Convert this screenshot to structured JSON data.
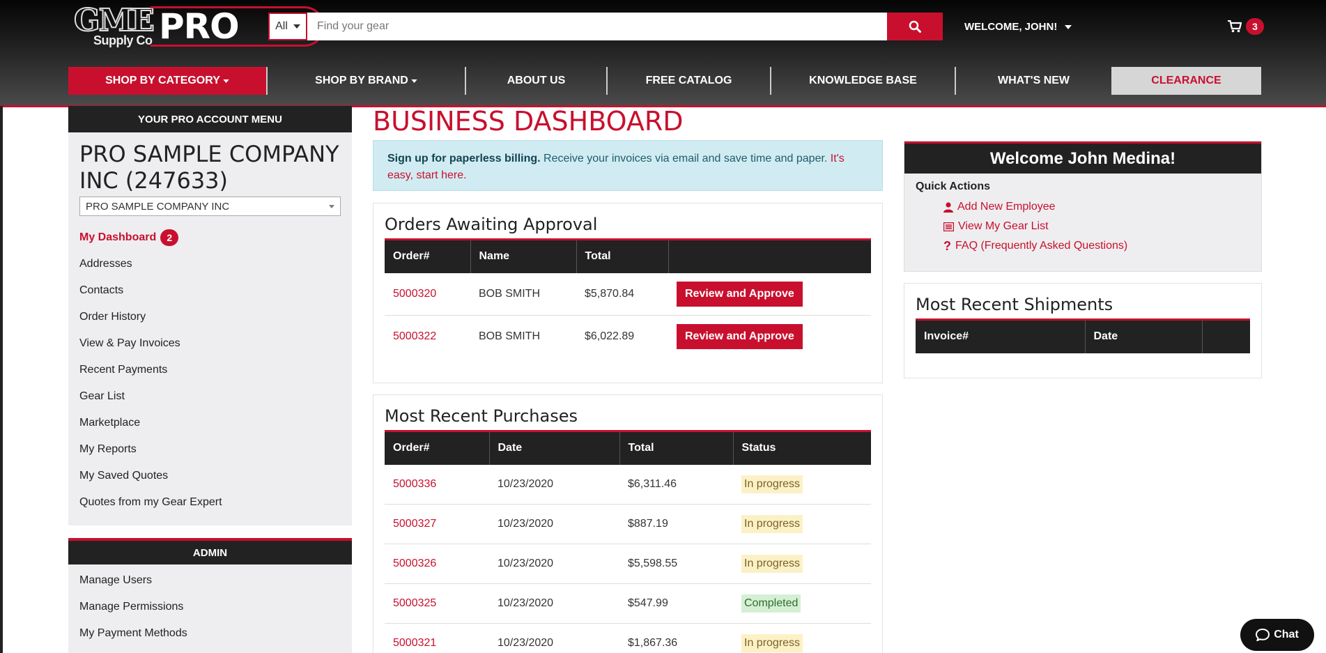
{
  "header": {
    "logo": {
      "brand": "GME",
      "sub": "Supply Co",
      "pro": "PRO"
    },
    "search": {
      "category": "All",
      "placeholder": "Find your gear"
    },
    "welcome": "WELCOME, JOHN!",
    "cart_count": "3"
  },
  "nav": [
    {
      "label": "SHOP BY CATEGORY",
      "caret": true
    },
    {
      "label": "SHOP BY BRAND",
      "caret": true
    },
    {
      "label": "ABOUT US"
    },
    {
      "label": "FREE CATALOG"
    },
    {
      "label": "KNOWLEDGE BASE"
    },
    {
      "label": "WHAT'S NEW"
    },
    {
      "label": "CLEARANCE"
    }
  ],
  "sidebar": {
    "header": "YOUR PRO ACCOUNT MENU",
    "company": "PRO SAMPLE COMPANY INC (247633)",
    "company_select": "PRO SAMPLE COMPANY INC",
    "links": [
      {
        "label": "My Dashboard",
        "badge": "2"
      },
      {
        "label": "Addresses"
      },
      {
        "label": "Contacts"
      },
      {
        "label": "Order History"
      },
      {
        "label": "View & Pay Invoices"
      },
      {
        "label": "Recent Payments"
      },
      {
        "label": "Gear List"
      },
      {
        "label": "Marketplace"
      },
      {
        "label": "My Reports"
      },
      {
        "label": "My Saved Quotes"
      },
      {
        "label": "Quotes from my Gear Expert"
      }
    ],
    "admin_header": "ADMIN",
    "admin_links": [
      "Manage Users",
      "Manage Permissions",
      "My Payment Methods"
    ]
  },
  "main": {
    "title": "BUSINESS DASHBOARD",
    "notice": {
      "bold": "Sign up for paperless billing.",
      "text": " Receive your invoices via email and save time and paper. ",
      "link": "It's easy, start here."
    },
    "approval": {
      "title": "Orders Awaiting Approval",
      "columns": [
        "Order#",
        "Name",
        "Total",
        ""
      ],
      "rows": [
        {
          "order": "5000320",
          "name": "BOB SMITH",
          "total": "$5,870.84",
          "action": "Review and Approve"
        },
        {
          "order": "5000322",
          "name": "BOB SMITH",
          "total": "$6,022.89",
          "action": "Review and Approve"
        }
      ]
    },
    "purchases": {
      "title": "Most Recent Purchases",
      "columns": [
        "Order#",
        "Date",
        "Total",
        "Status"
      ],
      "rows": [
        {
          "order": "5000336",
          "date": "10/23/2020",
          "total": "$6,311.46",
          "status": "In progress"
        },
        {
          "order": "5000327",
          "date": "10/23/2020",
          "total": "$887.19",
          "status": "In progress"
        },
        {
          "order": "5000326",
          "date": "10/23/2020",
          "total": "$5,598.55",
          "status": "In progress"
        },
        {
          "order": "5000325",
          "date": "10/23/2020",
          "total": "$547.99",
          "status": "Completed"
        },
        {
          "order": "5000321",
          "date": "10/23/2020",
          "total": "$1,867.36",
          "status": "In progress"
        }
      ]
    }
  },
  "right": {
    "welcome_title": "Welcome John Medina!",
    "quick_actions_label": "Quick Actions",
    "actions": [
      {
        "label": "Add New Employee",
        "icon": "user-icon"
      },
      {
        "label": "View My Gear List",
        "icon": "list-icon"
      },
      {
        "label": "FAQ (Frequently Asked Questions)",
        "icon": "question-icon"
      }
    ],
    "shipments": {
      "title": "Most Recent Shipments",
      "columns": [
        "Invoice#",
        "Date",
        ""
      ]
    }
  },
  "chat": {
    "label": "Chat"
  },
  "colors": {
    "brand_red": "#c8102e",
    "dark": "#222222",
    "panel_gray": "#eeeef0",
    "notice_blue": "#d0ecf2"
  }
}
